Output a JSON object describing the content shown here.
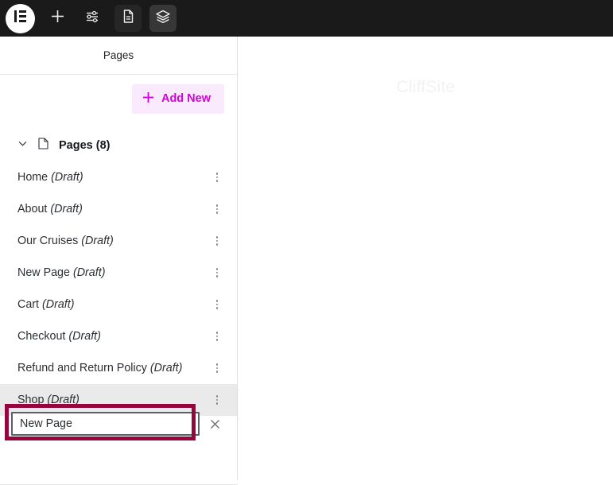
{
  "toolbar": {
    "logo": "elementor-logo",
    "buttons": [
      {
        "name": "add-element-button",
        "icon": "plus-icon",
        "label": "+"
      },
      {
        "name": "site-settings-button",
        "icon": "sliders-icon",
        "label": ""
      },
      {
        "name": "page-settings-button",
        "icon": "document-icon",
        "label": "",
        "active": true
      },
      {
        "name": "structure-button",
        "icon": "layers-icon",
        "label": ""
      }
    ]
  },
  "sidebar": {
    "panel_title": "Pages",
    "add_new_label": "Add New",
    "add_new_icon": "plus-icon",
    "group": {
      "label": "Pages (8)",
      "icon": "page-file-icon",
      "chevron": "chevron-down-icon",
      "count": 8,
      "expanded": true
    },
    "pages": [
      {
        "title": "Home",
        "status": "(Draft)",
        "hover": false
      },
      {
        "title": "About",
        "status": "(Draft)",
        "hover": false
      },
      {
        "title": "Our Cruises",
        "status": "(Draft)",
        "hover": false
      },
      {
        "title": "New Page",
        "status": "(Draft)",
        "hover": false
      },
      {
        "title": "Cart",
        "status": "(Draft)",
        "hover": false
      },
      {
        "title": "Checkout",
        "status": "(Draft)",
        "hover": false
      },
      {
        "title": "Refund and Return Policy",
        "status": "(Draft)",
        "hover": false
      },
      {
        "title": "Shop",
        "status": "(Draft)",
        "hover": true
      }
    ],
    "rename_field": {
      "value": "New Page",
      "placeholder": "New Page",
      "close_icon": "close-x-icon"
    },
    "collapse_icon": "chevron-left-icon"
  },
  "canvas": {
    "watermark": "CliffSite"
  },
  "colors": {
    "toolbar_bg": "#1a1a1a",
    "accent_pink": "#d004d4",
    "accent_pink_bg": "#faeafd",
    "row_hover": "#eaeaea",
    "annotation": "#95063f",
    "input_border": "#5b6066"
  }
}
